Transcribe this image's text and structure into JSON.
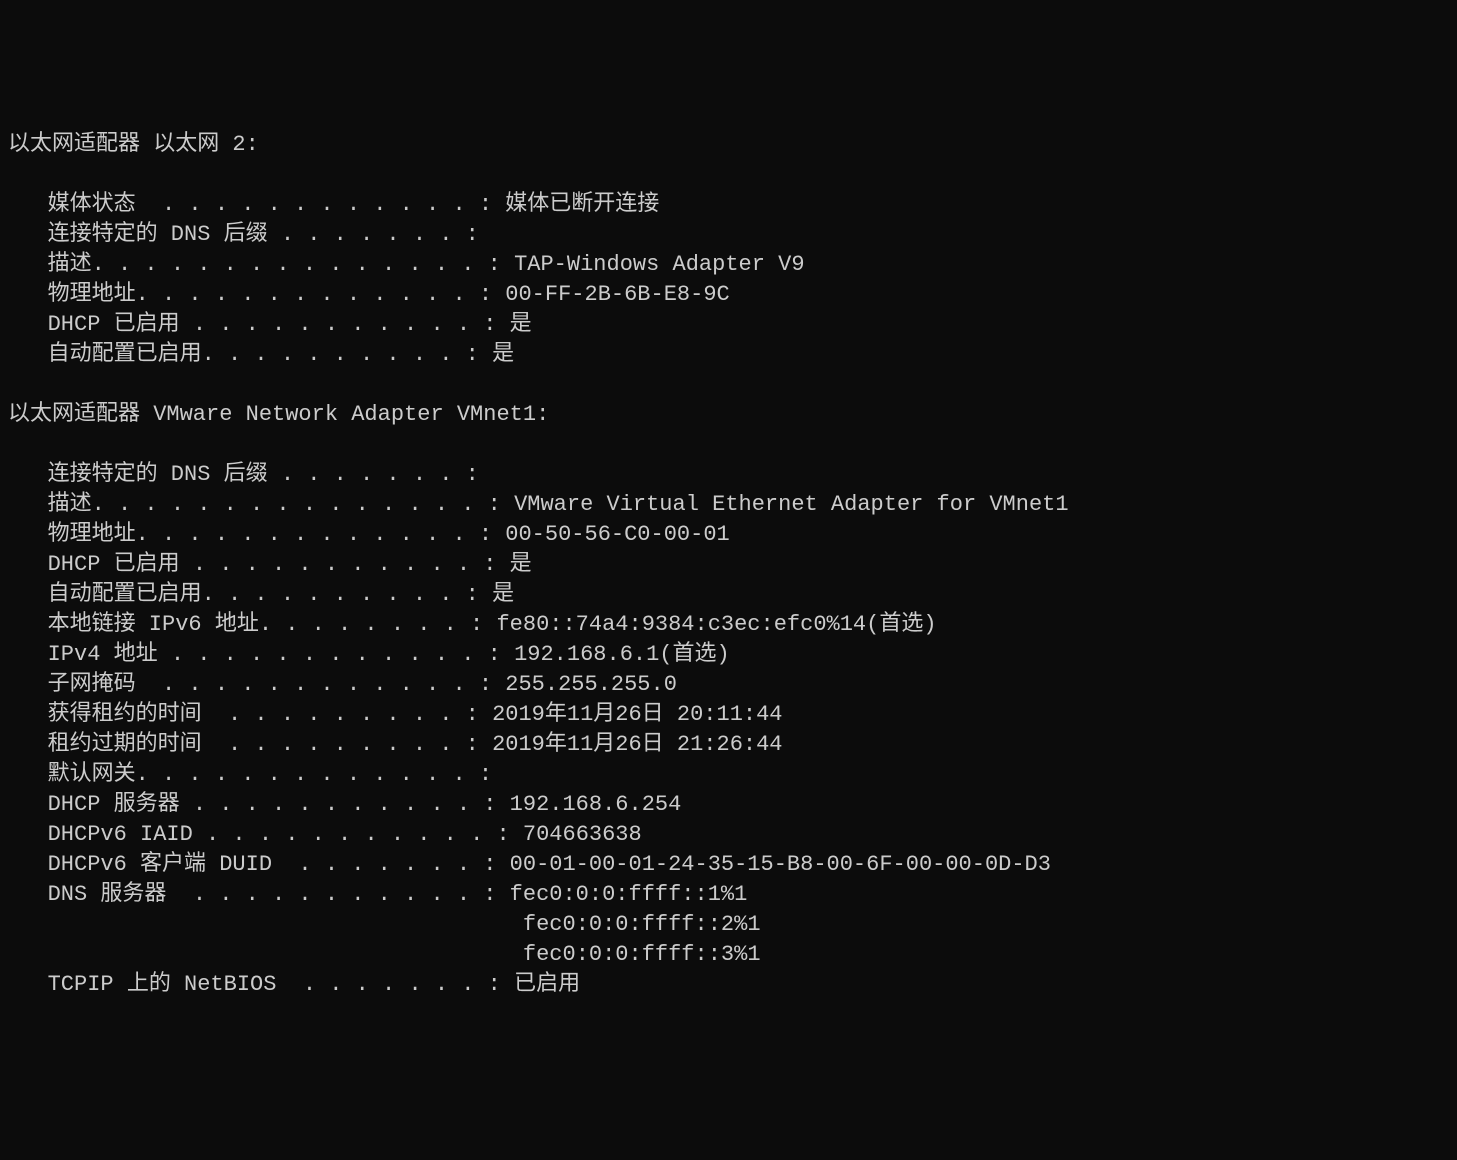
{
  "adapter1": {
    "header": "以太网适配器 以太网 2:",
    "media_state_label": "   媒体状态  . . . . . . . . . . . . : ",
    "media_state_value": "媒体已断开连接",
    "dns_suffix_label": "   连接特定的 DNS 后缀 . . . . . . . :",
    "dns_suffix_value": "",
    "description_label": "   描述. . . . . . . . . . . . . . . : ",
    "description_value": "TAP-Windows Adapter V9",
    "physical_addr_label": "   物理地址. . . . . . . . . . . . . : ",
    "physical_addr_value": "00-FF-2B-6B-E8-9C",
    "dhcp_enabled_label": "   DHCP 已启用 . . . . . . . . . . . : ",
    "dhcp_enabled_value": "是",
    "autoconfig_label": "   自动配置已启用. . . . . . . . . . : ",
    "autoconfig_value": "是"
  },
  "adapter2": {
    "header": "以太网适配器 VMware Network Adapter VMnet1:",
    "dns_suffix_label": "   连接特定的 DNS 后缀 . . . . . . . :",
    "dns_suffix_value": "",
    "description_label": "   描述. . . . . . . . . . . . . . . : ",
    "description_value": "VMware Virtual Ethernet Adapter for VMnet1",
    "physical_addr_label": "   物理地址. . . . . . . . . . . . . : ",
    "physical_addr_value": "00-50-56-C0-00-01",
    "dhcp_enabled_label": "   DHCP 已启用 . . . . . . . . . . . : ",
    "dhcp_enabled_value": "是",
    "autoconfig_label": "   自动配置已启用. . . . . . . . . . : ",
    "autoconfig_value": "是",
    "link_local_v6_label": "   本地链接 IPv6 地址. . . . . . . . : ",
    "link_local_v6_value": "fe80::74a4:9384:c3ec:efc0%14(首选)",
    "ipv4_label": "   IPv4 地址 . . . . . . . . . . . . : ",
    "ipv4_value": "192.168.6.1(首选)",
    "subnet_label": "   子网掩码  . . . . . . . . . . . . : ",
    "subnet_value": "255.255.255.0",
    "lease_obtained_label": "   获得租约的时间  . . . . . . . . . : ",
    "lease_obtained_value": "2019年11月26日 20:11:44",
    "lease_expires_label": "   租约过期的时间  . . . . . . . . . : ",
    "lease_expires_value": "2019年11月26日 21:26:44",
    "default_gw_label": "   默认网关. . . . . . . . . . . . . :",
    "default_gw_value": "",
    "dhcp_server_label": "   DHCP 服务器 . . . . . . . . . . . : ",
    "dhcp_server_value": "192.168.6.254",
    "dhcpv6_iaid_label": "   DHCPv6 IAID . . . . . . . . . . . : ",
    "dhcpv6_iaid_value": "704663638",
    "dhcpv6_duid_label": "   DHCPv6 客户端 DUID  . . . . . . . : ",
    "dhcpv6_duid_value": "00-01-00-01-24-35-15-B8-00-6F-00-00-0D-D3",
    "dns_servers_label": "   DNS 服务器  . . . . . . . . . . . : ",
    "dns_servers_value": "fec0:0:0:ffff::1%1",
    "dns_servers_indent2": "                                       fec0:0:0:ffff::2%1",
    "dns_servers_indent3": "                                       fec0:0:0:ffff::3%1",
    "netbios_label": "   TCPIP 上的 NetBIOS  . . . . . . . : ",
    "netbios_value": "已启用"
  }
}
